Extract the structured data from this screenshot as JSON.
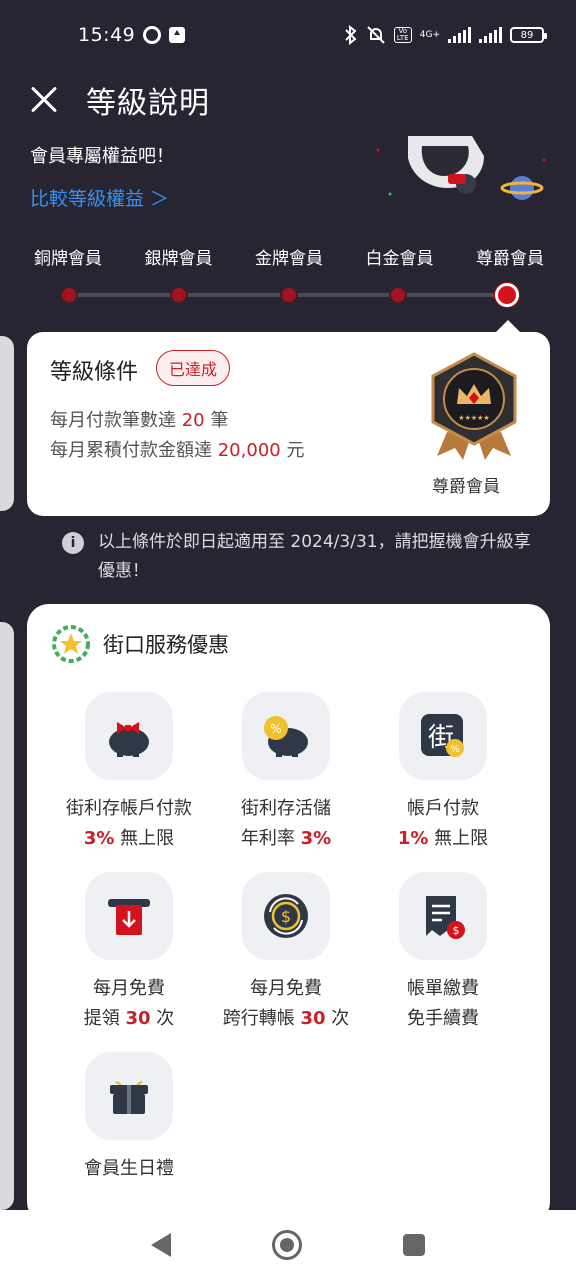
{
  "status": {
    "time": "15:49",
    "volte_top": "Vo",
    "volte_bottom": "LTE",
    "net": "4G+",
    "battery": "89"
  },
  "header": {
    "title": "等級說明"
  },
  "intro": {
    "text": "會員專屬權益吧！",
    "compare_link": "比較等級權益 ＞"
  },
  "levels": {
    "items": [
      "銅牌會員",
      "銀牌會員",
      "金牌會員",
      "白金會員",
      "尊爵會員"
    ],
    "active_index": 4
  },
  "condition": {
    "title": "等級條件",
    "badge": "已達成",
    "line1_pre": "每月付款筆數達 ",
    "line1_value": "20",
    "line1_post": " 筆",
    "line2_pre": "每月累積付款金額達 ",
    "line2_value": "20,000",
    "line2_post": " 元",
    "tier_name": "尊爵會員"
  },
  "notice": {
    "text": "以上條件於即日起適用至 2024/3/31，請把握機會升級享優惠！"
  },
  "services": {
    "title": "街口服務優惠",
    "items": [
      {
        "label": "街利存帳戶付款",
        "value": "3%",
        "suffix": " 無上限",
        "prefix": ""
      },
      {
        "label": "街利存活儲",
        "prefix": "年利率 ",
        "value": "3%",
        "suffix": ""
      },
      {
        "label": "帳戶付款",
        "value": "1%",
        "suffix": " 無上限",
        "prefix": ""
      },
      {
        "label": "每月免費",
        "prefix": "提領 ",
        "value": "30",
        "suffix": " 次"
      },
      {
        "label": "每月免費",
        "prefix": "跨行轉帳 ",
        "value": "30",
        "suffix": " 次"
      },
      {
        "label": "帳單繳費",
        "prefix": "免手續費",
        "value": "",
        "suffix": ""
      },
      {
        "label": "會員生日禮",
        "prefix": "",
        "value": "",
        "suffix": ""
      }
    ]
  },
  "colors": {
    "accent_red": "#c9202a",
    "link_blue": "#3b8ff0",
    "background": "#262531"
  }
}
